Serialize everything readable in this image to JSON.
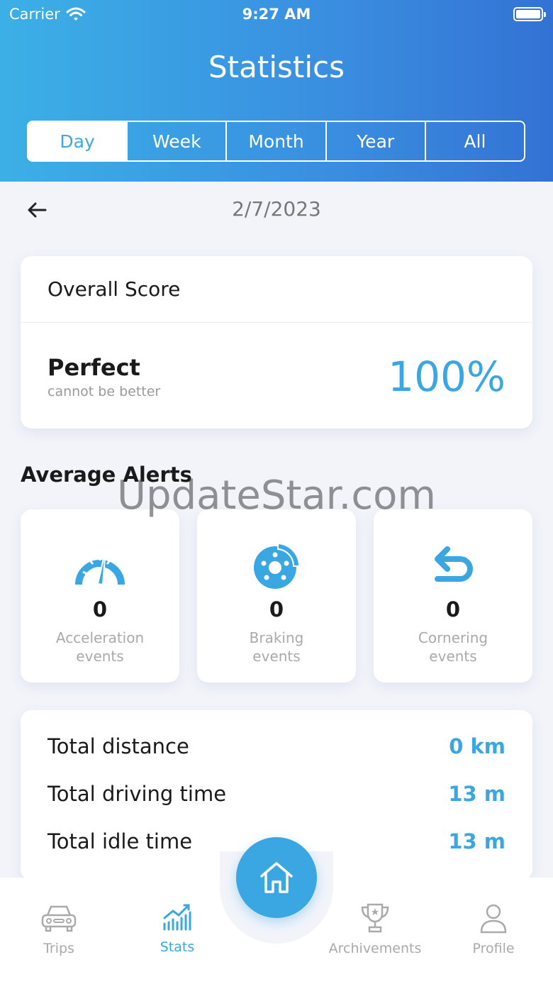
{
  "status": {
    "carrier": "Carrier",
    "time": "9:27 AM"
  },
  "header": {
    "title": "Statistics"
  },
  "tabs": [
    {
      "label": "Day",
      "active": true
    },
    {
      "label": "Week",
      "active": false
    },
    {
      "label": "Month",
      "active": false
    },
    {
      "label": "Year",
      "active": false
    },
    {
      "label": "All",
      "active": false
    }
  ],
  "date": "2/7/2023",
  "score": {
    "heading": "Overall Score",
    "rating": "Perfect",
    "caption": "cannot be better",
    "value": "100%"
  },
  "alerts": {
    "title": "Average Alerts",
    "items": [
      {
        "icon": "speedometer-icon",
        "count": "0",
        "line1": "Acceleration",
        "line2": "events"
      },
      {
        "icon": "brake-disc-icon",
        "count": "0",
        "line1": "Braking",
        "line2": "events"
      },
      {
        "icon": "u-turn-icon",
        "count": "0",
        "line1": "Cornering",
        "line2": "events"
      }
    ]
  },
  "totals": [
    {
      "label": "Total distance",
      "value": "0 km"
    },
    {
      "label": "Total driving time",
      "value": "13 m"
    },
    {
      "label": "Total idle time",
      "value": "13 m"
    }
  ],
  "watermark": "UpdateStar.com",
  "nav": [
    {
      "label": "Trips",
      "icon": "car-icon"
    },
    {
      "label": "Stats",
      "icon": "stats-icon",
      "active": true
    },
    {
      "label": "Archivements",
      "icon": "trophy-icon"
    },
    {
      "label": "Profile",
      "icon": "profile-icon"
    }
  ],
  "colors": {
    "accent": "#3aa7e3",
    "header_start": "#3bb0e6",
    "header_end": "#3372d4"
  }
}
